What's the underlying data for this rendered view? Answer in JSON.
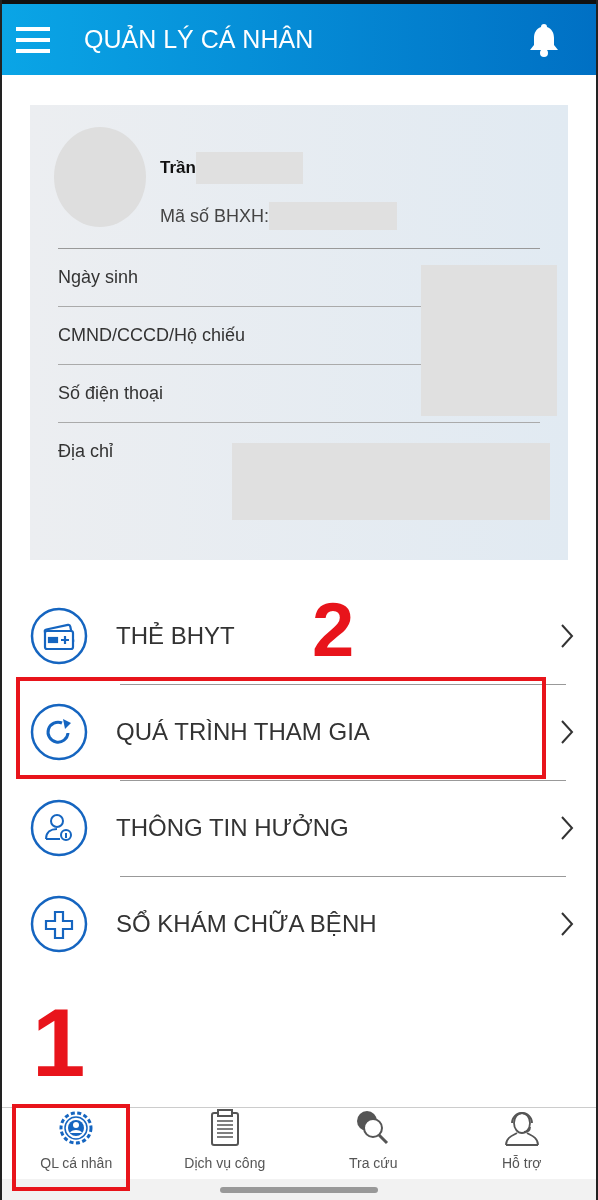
{
  "header": {
    "title": "QUẢN LÝ CÁ NHÂN"
  },
  "profile": {
    "name": "Trần",
    "id_label": "Mã số BHXH:",
    "fields": [
      {
        "label": "Ngày sinh"
      },
      {
        "label": "CMND/CCCD/Hộ chiếu"
      },
      {
        "label": "Số điện thoại"
      },
      {
        "label": "Địa chỉ"
      }
    ]
  },
  "menu_items": [
    {
      "kind": "card",
      "label": "THẺ BHYT",
      "highlighted": false
    },
    {
      "kind": "history",
      "label": "QUÁ TRÌNH THAM GIA",
      "highlighted": true,
      "callout": "2"
    },
    {
      "kind": "info",
      "label": "THÔNG TIN HƯỞNG",
      "highlighted": false
    },
    {
      "kind": "medical",
      "label": "SỔ KHÁM CHỮA BỆNH",
      "highlighted": false
    }
  ],
  "tabs": [
    {
      "kind": "personal",
      "label": "QL cá nhân",
      "selected": true,
      "highlighted": true,
      "callout": "1"
    },
    {
      "kind": "services",
      "label": "Dịch vụ công",
      "selected": false,
      "highlighted": false
    },
    {
      "kind": "lookup",
      "label": "Tra cứu",
      "selected": false,
      "highlighted": false
    },
    {
      "kind": "support",
      "label": "Hỗ trợ",
      "selected": false,
      "highlighted": false
    }
  ]
}
